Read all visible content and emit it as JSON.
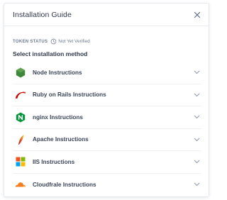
{
  "dialog": {
    "title": "Installation Guide",
    "close_icon": "close-icon"
  },
  "token": {
    "label": "TOKEN STATUS",
    "status_icon": "clock-icon",
    "status_text": "Not Yet Verified",
    "status_color": "#6b7a8f"
  },
  "section_title": "Select installation method",
  "items": [
    {
      "label": "Node Instructions",
      "icon": "nodejs-icon"
    },
    {
      "label": "Ruby on Rails Instructions",
      "icon": "rails-icon"
    },
    {
      "label": "nginx Instructions",
      "icon": "nginx-icon"
    },
    {
      "label": "Apache Instructions",
      "icon": "apache-feather-icon"
    },
    {
      "label": "IIS Instructions",
      "icon": "windows-icon"
    },
    {
      "label": "Cloudfrale Instructions",
      "icon": "cloudflare-icon"
    }
  ],
  "colors": {
    "node": "#3c873a",
    "rails": "#cc0000",
    "nginx": "#009639",
    "apache": "#d22128",
    "windows_red": "#f25022",
    "windows_green": "#7fba00",
    "windows_blue": "#00a4ef",
    "windows_yellow": "#ffb900",
    "cloudflare": "#f38020"
  }
}
